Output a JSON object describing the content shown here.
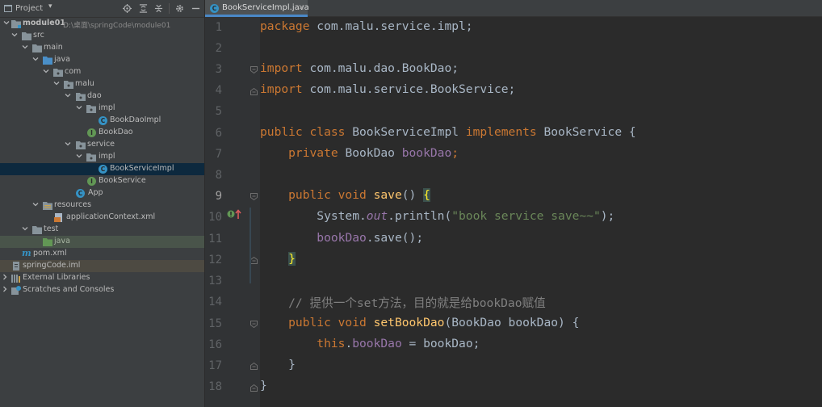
{
  "project_panel": {
    "title": "Project",
    "tree": [
      {
        "label": "module01",
        "extra": "D:\\桌面\\springCode\\module01"
      },
      {
        "label": "src"
      },
      {
        "label": "main"
      },
      {
        "label": "java"
      },
      {
        "label": "com"
      },
      {
        "label": "malu"
      },
      {
        "label": "dao"
      },
      {
        "label": "impl"
      },
      {
        "label": "BookDaoImpl"
      },
      {
        "label": "BookDao"
      },
      {
        "label": "service"
      },
      {
        "label": "impl"
      },
      {
        "label": "BookServiceImpl"
      },
      {
        "label": "BookService"
      },
      {
        "label": "App"
      },
      {
        "label": "resources"
      },
      {
        "label": "applicationContext.xml"
      },
      {
        "label": "test"
      },
      {
        "label": "java"
      },
      {
        "label": "pom.xml"
      },
      {
        "label": "springCode.iml"
      },
      {
        "label": "External Libraries"
      },
      {
        "label": "Scratches and Consoles"
      }
    ]
  },
  "editor": {
    "tab": {
      "label": "BookServiceImpl.java",
      "close": "×"
    },
    "line_numbers": [
      "1",
      "2",
      "3",
      "4",
      "5",
      "6",
      "7",
      "8",
      "9",
      "10",
      "11",
      "12",
      "13",
      "14",
      "15",
      "16",
      "17",
      "18"
    ],
    "code": {
      "l1a": "package",
      "l1b": " com.malu.service.impl;",
      "l3a": "import",
      "l3b": " com.malu.dao.BookDao;",
      "l4a": "import",
      "l4b": " com.malu.service.BookService;",
      "l6a": "public class",
      "l6b": " BookServiceImpl ",
      "l6c": "implements",
      "l6d": " BookService {",
      "l7a": "    private",
      "l7b": " BookDao ",
      "l7c": "bookDao",
      "l7d": ";",
      "l9a": "    public void",
      "l9b": " save",
      "l9c": "() ",
      "l9d": "{",
      "l10a": "        System.",
      "l10b": "out",
      "l10c": ".println(",
      "l10d": "\"book service save~~\"",
      "l10e": ");",
      "l11a": "        ",
      "l11b": "bookDao",
      "l11c": ".save();",
      "l12a": "    ",
      "l12b": "}",
      "l14": "    // 提供一个set方法，目的就是给bookDao赋值",
      "l15a": "    public void",
      "l15b": " setBookDao",
      "l15c": "(BookDao bookDao) {",
      "l16a": "        this",
      "l16b": ".",
      "l16c": "bookDao",
      "l16d": " = bookDao;",
      "l17": "    }",
      "l18": "}"
    }
  },
  "colors": {
    "background": "#2b2b2b",
    "panel": "#3c3f41",
    "keyword": "#cc7832",
    "field": "#9876aa",
    "string": "#6a8759",
    "method": "#ffc66d",
    "comment": "#808080",
    "selection": "#0d293e"
  },
  "icons": [
    "project-icon",
    "locate-icon",
    "expand-all-icon",
    "collapse-all-icon",
    "settings-icon",
    "minimize-icon",
    "module-folder-icon",
    "folder-icon",
    "class-icon",
    "interface-icon",
    "xml-file-icon",
    "maven-icon",
    "iml-file-icon",
    "library-icon",
    "scratches-icon",
    "implements-icon",
    "fold-icon"
  ]
}
